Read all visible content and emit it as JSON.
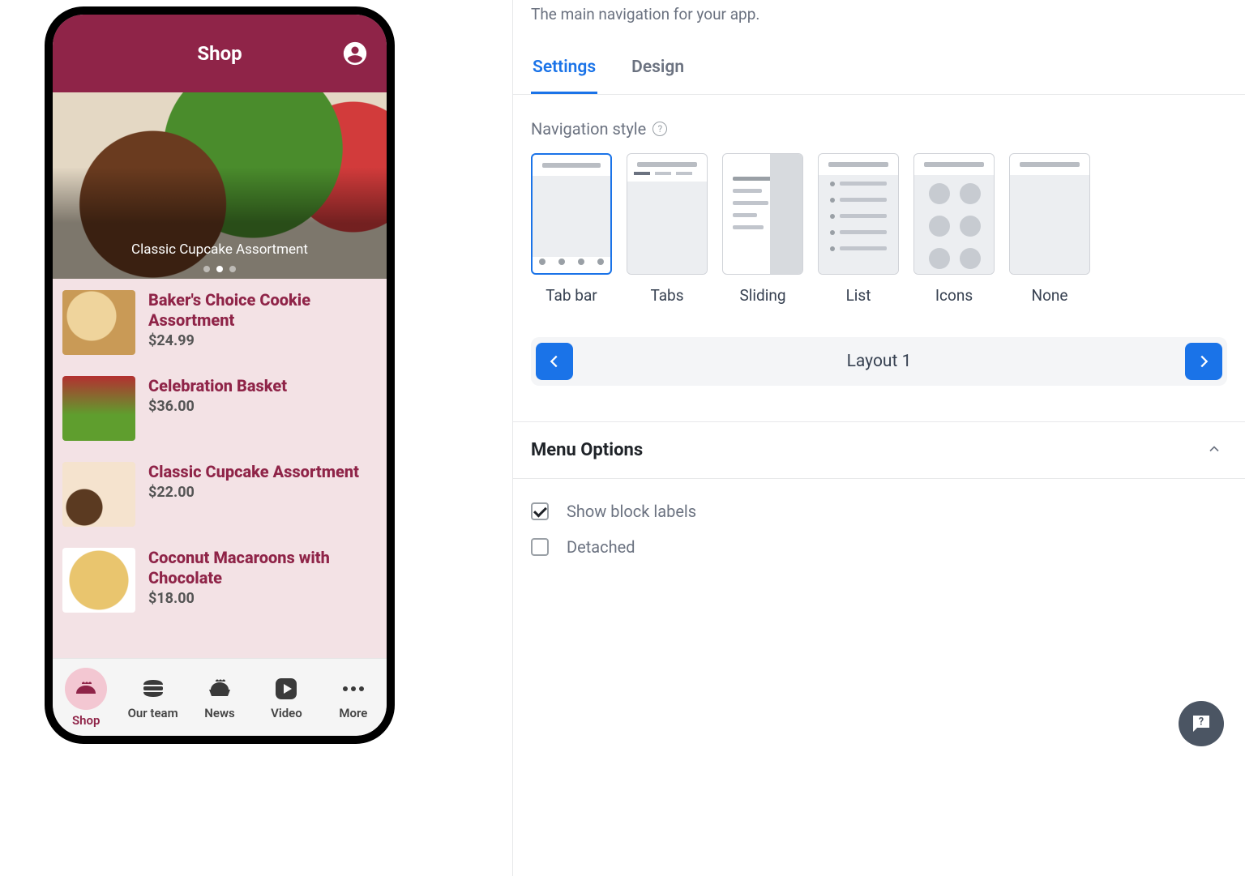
{
  "preview": {
    "title": "Shop",
    "hero_caption": "Classic Cupcake Assortment",
    "carousel_index": 1,
    "carousel_count": 3,
    "products": [
      {
        "name": "Baker's Choice Cookie Assortment",
        "price": "$24.99"
      },
      {
        "name": "Celebration Basket",
        "price": "$36.00"
      },
      {
        "name": "Classic Cupcake Assortment",
        "price": "$22.00"
      },
      {
        "name": "Coconut Macaroons with Chocolate",
        "price": "$18.00"
      }
    ],
    "tabs": [
      {
        "label": "Shop",
        "icon": "dish-icon",
        "active": true
      },
      {
        "label": "Our team",
        "icon": "burger-icon",
        "active": false
      },
      {
        "label": "News",
        "icon": "pie-icon",
        "active": false
      },
      {
        "label": "Video",
        "icon": "play-icon",
        "active": false
      },
      {
        "label": "More",
        "icon": "dots-icon",
        "active": false
      }
    ]
  },
  "panel": {
    "description": "The main navigation for your app.",
    "tabs": {
      "settings": "Settings",
      "design": "Design"
    },
    "active_tab": "settings",
    "nav_style_label": "Navigation style",
    "nav_styles": [
      {
        "key": "tabbar",
        "label": "Tab bar"
      },
      {
        "key": "tabs",
        "label": "Tabs"
      },
      {
        "key": "sliding",
        "label": "Sliding"
      },
      {
        "key": "list",
        "label": "List"
      },
      {
        "key": "icons",
        "label": "Icons"
      },
      {
        "key": "none",
        "label": "None"
      }
    ],
    "selected_nav_style": "tabbar",
    "layout_label": "Layout 1",
    "menu_options_title": "Menu Options",
    "options": {
      "show_block_labels": {
        "label": "Show block labels",
        "checked": true
      },
      "detached": {
        "label": "Detached",
        "checked": false
      }
    }
  },
  "colors": {
    "brand": "#8f2448",
    "accent": "#1a73e8"
  }
}
